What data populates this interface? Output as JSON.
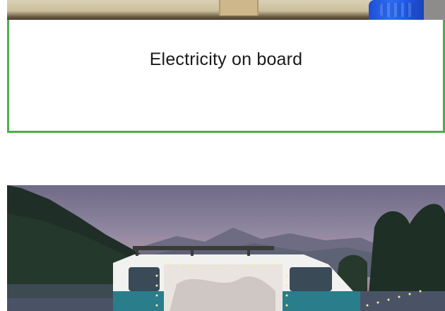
{
  "card": {
    "title": "Electricity on board"
  },
  "images": {
    "top_photo": "photo-strip",
    "bottom_photo": "camper-van-lake-photo"
  },
  "colors": {
    "card_border": "#4fae4a",
    "background": "#ffffff"
  }
}
